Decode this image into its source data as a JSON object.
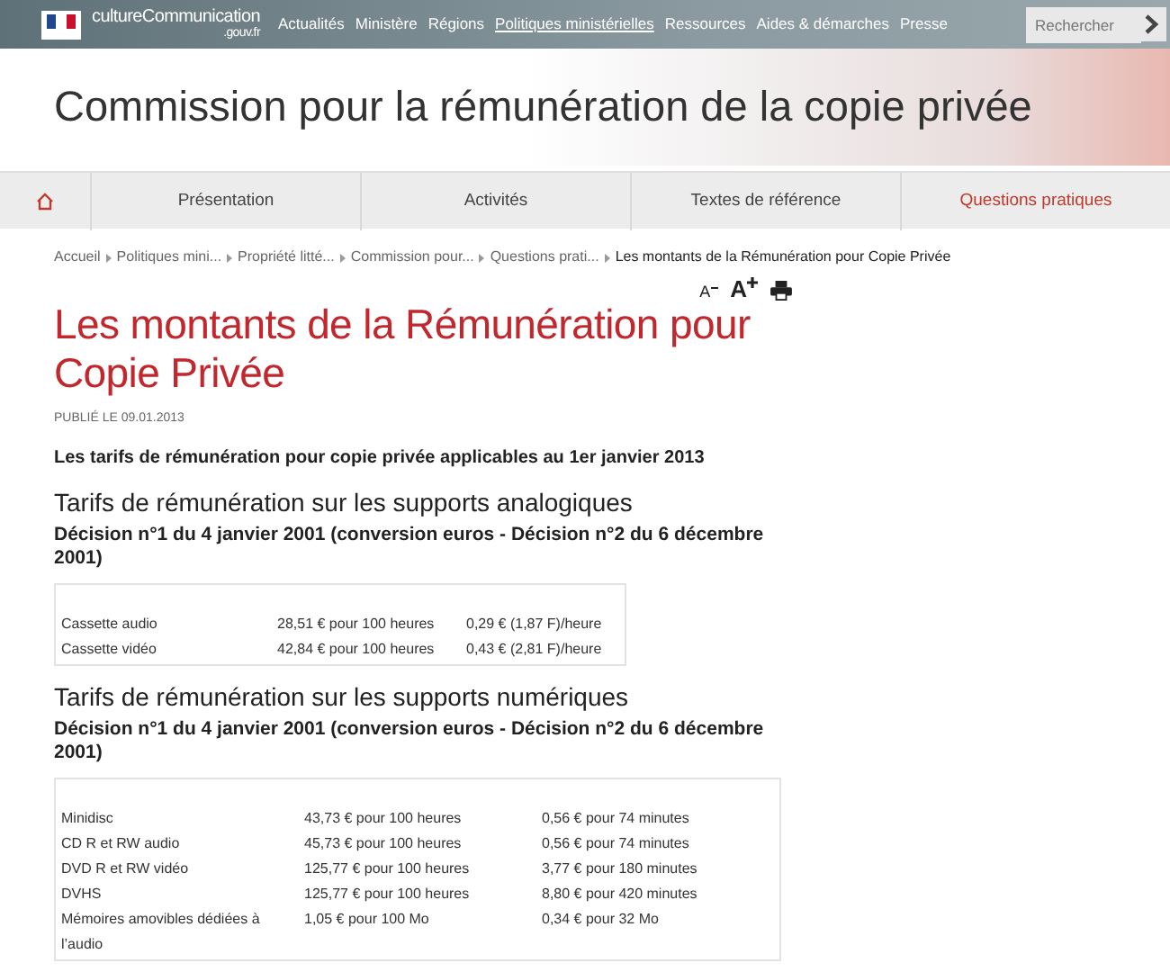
{
  "top_bar": {
    "logo_text": "cultureCommunication",
    "logo_suffix": ".gouv.fr",
    "menu": [
      {
        "label": "Actualités",
        "selected": false
      },
      {
        "label": "Ministère",
        "selected": false
      },
      {
        "label": "Régions",
        "selected": false
      },
      {
        "label": "Politiques ministérielles",
        "selected": true
      },
      {
        "label": "Ressources",
        "selected": false
      },
      {
        "label": "Aides & démarches",
        "selected": false
      },
      {
        "label": "Presse",
        "selected": false
      }
    ],
    "search": {
      "placeholder": "Rechercher"
    }
  },
  "banner": {
    "title": "Commission pour la rémunération de la copie privée"
  },
  "section_nav": [
    {
      "label": "Présentation",
      "selected": false
    },
    {
      "label": "Activités",
      "selected": false
    },
    {
      "label": "Textes de référence",
      "selected": false
    },
    {
      "label": "Questions pratiques",
      "selected": true
    }
  ],
  "breadcrumb": [
    "Accueil",
    "Politiques mini...",
    "Propriété litté...",
    "Commission pour...",
    "Questions prati...",
    "Les montants de la Rémunération pour Copie Privée"
  ],
  "tools": {
    "decrease": "A",
    "increase": "A"
  },
  "article": {
    "title": "Les montants de la Rémunération pour Copie Privée",
    "published": "PUBLIÉ LE 09.01.2013",
    "intro": "Les tarifs de rémunération pour copie privée applicables au 1er janvier 2013",
    "sections": [
      {
        "heading": "Tarifs de rémunération sur les supports analogiques",
        "subheading": "Décision n°1 du 4 janvier 2001 (conversion euros - Décision n°2 du 6 décembre 2001)",
        "rows": [
          [
            "Cassette audio",
            "28,51 € pour 100 heures",
            "0,29 € (1,87 F)/heure"
          ],
          [
            "Cassette vidéo",
            "42,84 € pour 100 heures",
            "0,43 € (2,81 F)/heure"
          ]
        ]
      },
      {
        "heading": "Tarifs de rémunération sur les supports numériques",
        "subheading": "Décision n°1 du 4 janvier 2001 (conversion euros - Décision n°2 du 6 décembre 2001)",
        "rows": [
          [
            "Minidisc",
            "43,73 € pour 100 heures",
            "0,56 € pour 74 minutes"
          ],
          [
            "CD R et RW audio",
            "45,73 € pour 100 heures",
            "0,56 € pour 74 minutes"
          ],
          [
            "DVD R et RW vidéo",
            "125,77 € pour 100 heures",
            "3,77 € pour 180 minutes"
          ],
          [
            "DVHS",
            "125,77 € pour 100 heures",
            "8,80 € pour 420 minutes"
          ],
          [
            "Mémoires amovibles dédiées à l’audio",
            "1,05 € pour 100 Mo",
            "0,34 € pour 32 Mo"
          ]
        ]
      }
    ]
  }
}
